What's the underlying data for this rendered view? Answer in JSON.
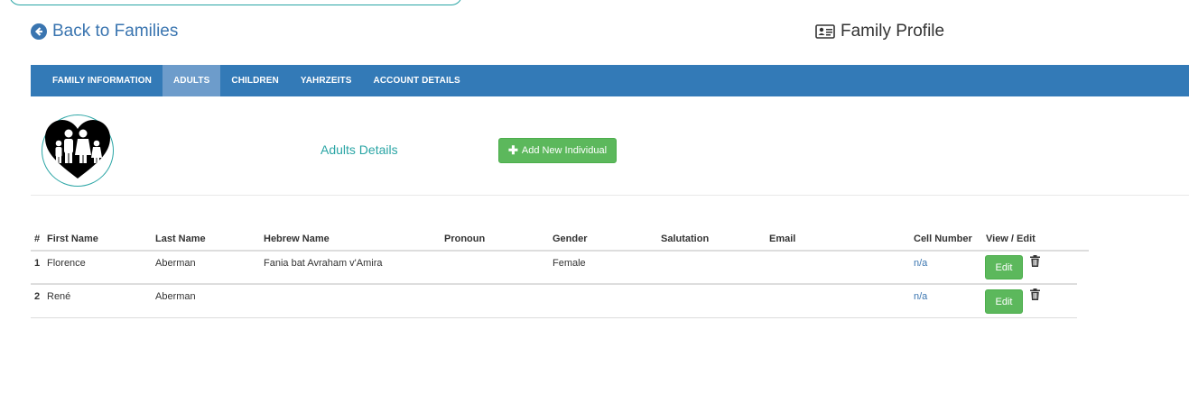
{
  "header": {
    "back_label": "Back to Families",
    "profile_title": "Family Profile"
  },
  "nav": {
    "tabs": [
      {
        "label": "FAMILY INFORMATION",
        "active": false
      },
      {
        "label": "ADULTS",
        "active": true
      },
      {
        "label": "CHILDREN",
        "active": false
      },
      {
        "label": "YAHRZEITS",
        "active": false
      },
      {
        "label": "ACCOUNT DETAILS",
        "active": false
      }
    ]
  },
  "section": {
    "title": "Adults Details",
    "add_button_label": "Add New Individual"
  },
  "table": {
    "columns": [
      "#",
      "First Name",
      "Last Name",
      "Hebrew Name",
      "Pronoun",
      "Gender",
      "Salutation",
      "Email",
      "Cell Number",
      "View / Edit"
    ],
    "rows": [
      {
        "num": "1",
        "first": "Florence",
        "last": "Aberman",
        "hebrew": "Fania bat Avraham v'Amira",
        "pronoun": "",
        "gender": "Female",
        "salutation": "",
        "email": "",
        "cell": "n/a",
        "edit_label": "Edit"
      },
      {
        "num": "2",
        "first": "René",
        "last": "Aberman",
        "hebrew": "",
        "pronoun": "",
        "gender": "",
        "salutation": "",
        "email": "",
        "cell": "n/a",
        "edit_label": "Edit"
      }
    ]
  },
  "colors": {
    "nav_bg": "#337ab7",
    "nav_active": "#6d9ccb",
    "accent_teal": "#2aa5a5",
    "button_green": "#5cb85c",
    "link_blue": "#3a75b0"
  },
  "icons": {
    "back": "arrow-left-circle-icon",
    "profile": "id-card-icon",
    "add": "plus-icon",
    "delete": "trash-icon",
    "avatar": "family-heart-icon"
  }
}
